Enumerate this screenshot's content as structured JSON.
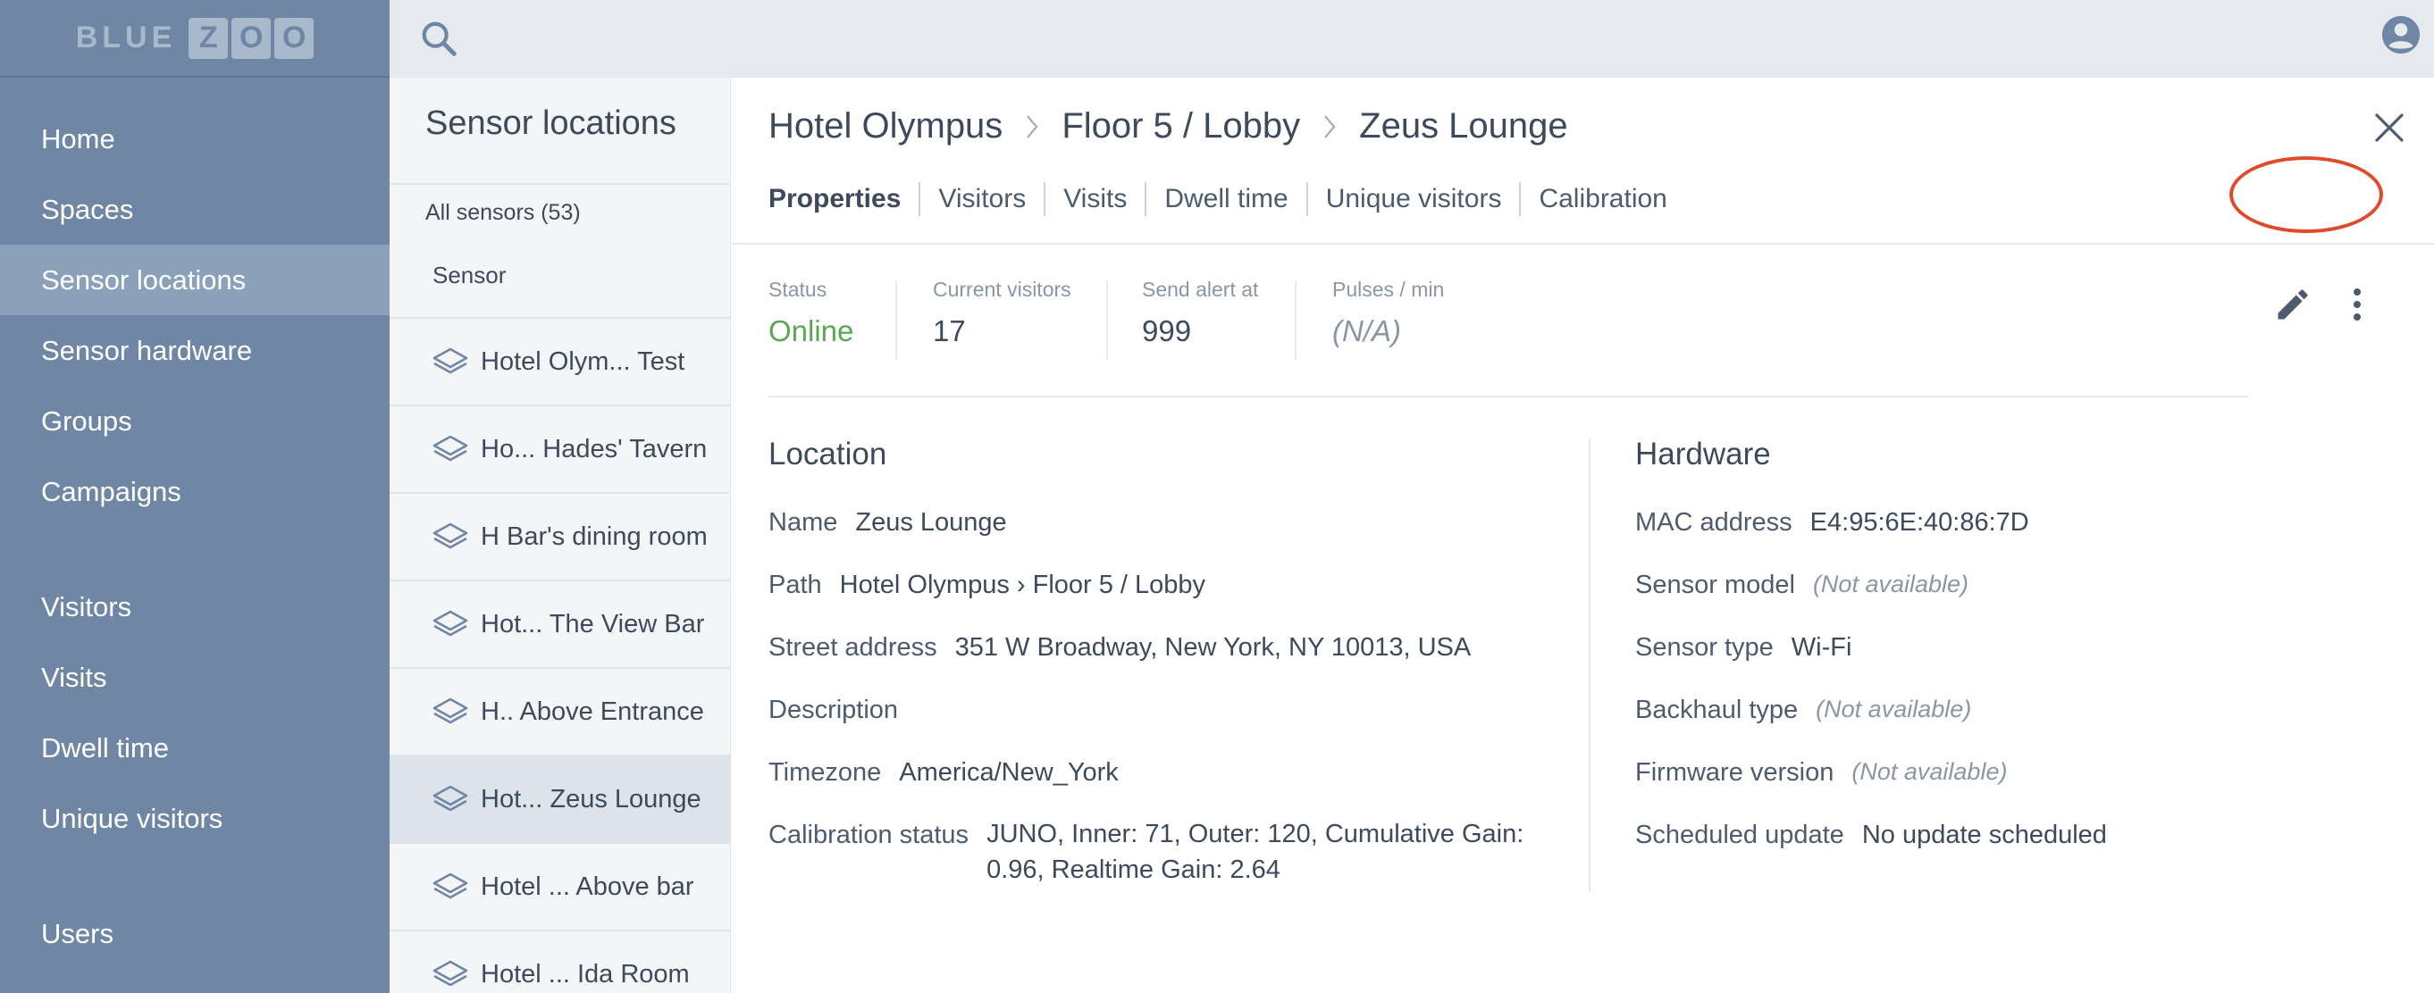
{
  "logo": {
    "word": "BLUE",
    "boxed": [
      "Z",
      "O",
      "O"
    ]
  },
  "sidebar": {
    "items": [
      {
        "label": "Home"
      },
      {
        "label": "Spaces"
      },
      {
        "label": "Sensor locations"
      },
      {
        "label": "Sensor hardware"
      },
      {
        "label": "Groups"
      },
      {
        "label": "Campaigns"
      },
      {
        "label": "Visitors"
      },
      {
        "label": "Visits"
      },
      {
        "label": "Dwell time"
      },
      {
        "label": "Unique visitors"
      },
      {
        "label": "Users"
      }
    ],
    "active_item": "Sensor locations"
  },
  "topbar": {
    "search_icon": "search-icon",
    "account_icon": "account-circle-icon"
  },
  "sensor_list": {
    "title": "Sensor locations",
    "count_label": "All sensors (53)",
    "column_header": "Sensor",
    "row_icon": "layers-icon",
    "rows": [
      {
        "text": "Hotel Olym...   Test"
      },
      {
        "text": "Ho... Hades' Tavern"
      },
      {
        "text": "H Bar's dining room"
      },
      {
        "text": "Hot... The View Bar"
      },
      {
        "text": "H.. Above Entrance"
      },
      {
        "text": "Hot...  Zeus Lounge"
      },
      {
        "text": "Hotel ...   Above bar"
      },
      {
        "text": "Hotel ...    Ida Room"
      }
    ],
    "selected_row": 5
  },
  "detail": {
    "breadcrumb": [
      "Hotel Olympus",
      "Floor 5 / Lobby",
      "Zeus Lounge"
    ],
    "tabs": [
      "Properties",
      "Visitors",
      "Visits",
      "Dwell time",
      "Unique visitors",
      "Calibration"
    ],
    "active_tab": "Properties",
    "highlighted_tab": "Calibration",
    "highlight_color": "#e04a2a",
    "stats": {
      "status_label": "Status",
      "status_value": "Online",
      "status_color": "#59a755",
      "visitors_label": "Current visitors",
      "visitors_value": "17",
      "alert_label": "Send alert at",
      "alert_value": "999",
      "pulses_label": "Pulses / min",
      "pulses_value": "(N/A)"
    },
    "location": {
      "title": "Location",
      "name_label": "Name",
      "name_value": "Zeus Lounge",
      "path_label": "Path",
      "path_value": "Hotel Olympus › Floor 5 / Lobby",
      "street_label": "Street address",
      "street_value": "351 W Broadway, New York, NY 10013, USA",
      "description_label": "Description",
      "timezone_label": "Timezone",
      "timezone_value": "America/New_York",
      "calibration_label": "Calibration status",
      "calibration_value": "JUNO, Inner: 71, Outer: 120, Cumulative Gain: 0.96, Realtime Gain: 2.64"
    },
    "hardware": {
      "title": "Hardware",
      "mac_label": "MAC address",
      "mac_value": "E4:95:6E:40:86:7D",
      "model_label": "Sensor model",
      "model_value": "(Not available)",
      "type_label": "Sensor type",
      "type_value": "Wi-Fi",
      "backhaul_label": "Backhaul type",
      "backhaul_value": "(Not available)",
      "firmware_label": "Firmware version",
      "firmware_value": "(Not available)",
      "update_label": "Scheduled update",
      "update_value": "No update scheduled"
    }
  }
}
